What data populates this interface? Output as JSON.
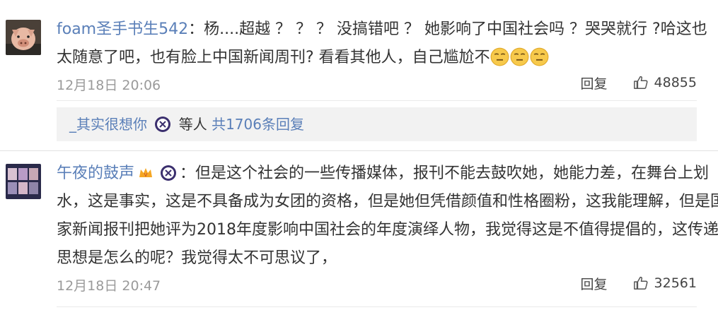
{
  "comments": [
    {
      "username": "foam圣手书生542",
      "line1": "：杨....超越 ？ ？ ？ 没搞错吧 ？ 她影响了中国社会吗 ？哭哭就行 ?哈这也",
      "line2": "太随意了吧，也有脸上中国新闻周刊? 看看其他人，自己尴尬不",
      "time": "12月18日 20:06",
      "reply_label": "回复",
      "likes": "48855"
    },
    {
      "username": "午夜的鼓声",
      "line1": "：但是这个社会的一些传播媒体，报刊不能去鼓吹她，她能力差，在舞台上划",
      "line2": "水，这是事实，这是不具备成为女团的资格，但是她但凭借颜值和性格圈粉，这我能理解，但是国",
      "line3": "家新闻报刊把她评为2018年度影响中国社会的年度演绎人物，我觉得这是不值得提倡的，这传递的",
      "line4": "思想是怎么的呢？我觉得太不可思议了，",
      "time": "12月18日 20:47",
      "reply_label": "回复",
      "likes": "32561"
    }
  ],
  "replies_summary": {
    "user": "_其实很想你",
    "middle": "等人",
    "link": "共1706条回复"
  },
  "colors": {
    "username": "#5a7fb8",
    "text": "#333333",
    "time": "#9a9a9a",
    "reply_bg": "#f2f2f2"
  },
  "icons": [
    "pig-avatar",
    "group-avatar",
    "awkward-emoji",
    "vip-badge",
    "night-badge",
    "thumbs-up-icon"
  ]
}
